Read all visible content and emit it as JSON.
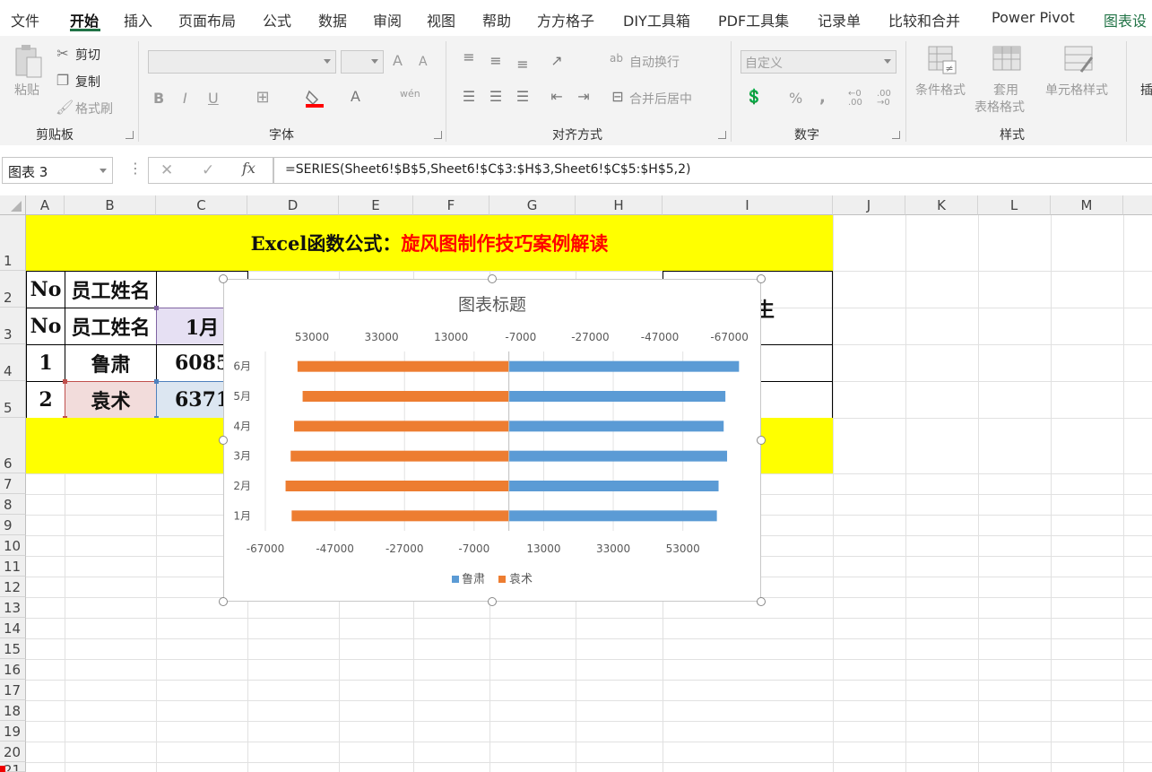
{
  "menu": {
    "tabs": [
      "文件",
      "开始",
      "插入",
      "页面布局",
      "公式",
      "数据",
      "审阅",
      "视图",
      "帮助",
      "方方格子",
      "DIY工具箱",
      "PDF工具集",
      "记录单",
      "比较和合并",
      "Power Pivot",
      "图表设"
    ],
    "active": "开始"
  },
  "ribbon": {
    "clipboard": {
      "paste": "粘贴",
      "cut": "剪切",
      "copy": "复制",
      "format_painter": "格式刷",
      "group": "剪贴板"
    },
    "font": {
      "group": "字体",
      "bold": "B",
      "italic": "I",
      "underline": "U",
      "grow": "A",
      "shrink": "A",
      "font_color": "A",
      "phonetic": "wén"
    },
    "alignment": {
      "wrap": "自动换行",
      "merge": "合并后居中",
      "group": "对齐方式",
      "wrap_icon": "ab"
    },
    "number": {
      "format": "自定义",
      "group": "数字",
      "percent": "%",
      "comma": ",",
      "inc_decimal": "←0 .00",
      "dec_decimal": ".00 →0"
    },
    "styles": {
      "conditional": "条件格式",
      "table_format_1": "套用",
      "table_format_2": "表格格式",
      "cell_styles": "单元格样式",
      "group": "样式"
    },
    "insert": {
      "label": "插"
    }
  },
  "formula_bar": {
    "name_box": "图表 3",
    "formula": "=SERIES(Sheet6!$B$5,Sheet6!$C$3:$H$3,Sheet6!$C$5:$H$5,2)",
    "cancel": "✕",
    "enter": "✓",
    "fx": "fx"
  },
  "columns": [
    "A",
    "B",
    "C",
    "D",
    "E",
    "F",
    "G",
    "H",
    "I",
    "J",
    "K",
    "L",
    "M"
  ],
  "rows": [
    "1",
    "2",
    "3",
    "4",
    "5",
    "6",
    "7",
    "8",
    "9",
    "10",
    "11",
    "12",
    "13",
    "14",
    "15",
    "16",
    "17",
    "18",
    "19",
    "20",
    "21"
  ],
  "sheet": {
    "title_black": "Excel函数公式：",
    "title_red": "旋风图制作技巧案例解读",
    "r2": {
      "a": "No",
      "b": "员工姓名",
      "i_partial": "生"
    },
    "r3": {
      "a": "No",
      "b": "员工姓名",
      "c": "1月"
    },
    "r4": {
      "a": "1",
      "b": "鲁肃",
      "c": "60855"
    },
    "r5": {
      "a": "2",
      "b": "袁术",
      "c": "63714"
    }
  },
  "colors": {
    "yellow": "#ffff00",
    "red": "#ff0000",
    "blue_series": "#5b9bd5",
    "orange_series": "#ed7d31",
    "green": "#217346"
  },
  "chart_data": {
    "type": "bar",
    "title": "图表标题",
    "categories": [
      "1月",
      "2月",
      "3月",
      "4月",
      "5月",
      "6月"
    ],
    "series": [
      {
        "name": "鲁肃",
        "values": [
          61000,
          61500,
          64000,
          63000,
          63500,
          67500
        ]
      },
      {
        "name": "袁术",
        "values": [
          63714,
          65500,
          64000,
          63000,
          60500,
          62000
        ]
      }
    ],
    "x_ticks_bottom": [
      "-67000",
      "-47000",
      "-27000",
      "-7000",
      "13000",
      "33000",
      "53000"
    ],
    "x_ticks_top": [
      "53000",
      "33000",
      "13000",
      "-7000",
      "-27000",
      "-47000",
      "-67000"
    ],
    "xlim": [
      -67000,
      67000
    ],
    "legend_position": "bottom",
    "grid": true
  }
}
